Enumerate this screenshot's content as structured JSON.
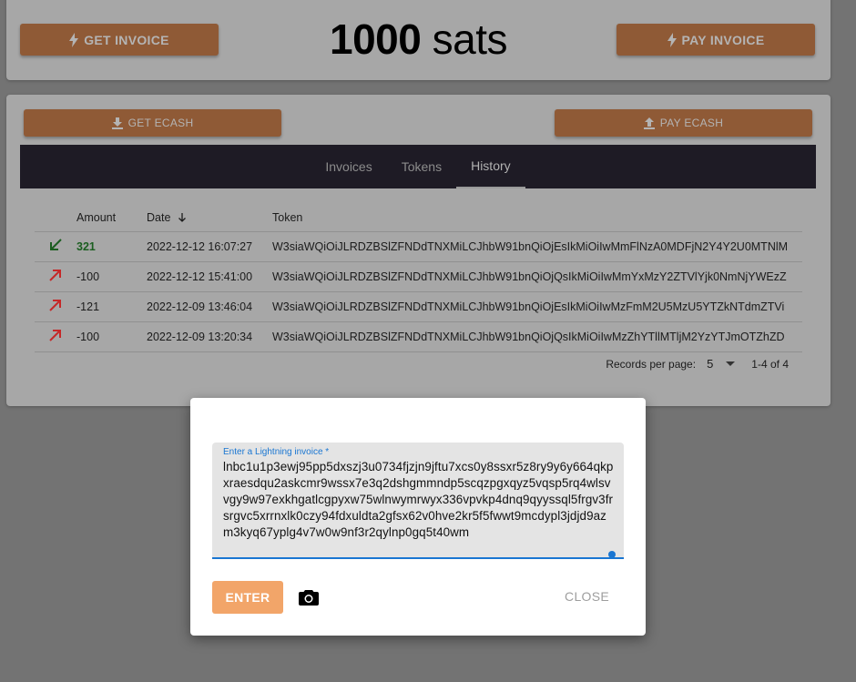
{
  "top": {
    "get_invoice_label": "GET INVOICE",
    "pay_invoice_label": "PAY INVOICE",
    "balance_number": "1000",
    "balance_unit": "sats"
  },
  "ecash": {
    "get_label": "GET ECASH",
    "pay_label": "PAY ECASH"
  },
  "tabs": [
    {
      "label": "Invoices"
    },
    {
      "label": "Tokens"
    },
    {
      "label": "History",
      "active": true
    }
  ],
  "history": {
    "columns": {
      "amount": "Amount",
      "date": "Date",
      "token": "Token"
    },
    "sort_icon": "arrow-down-icon",
    "rows": [
      {
        "direction": "incoming",
        "icon": "arrow-down-left-icon",
        "amount": "321",
        "date": "2022-12-12 16:07:27",
        "token": "W3siaWQiOiJLRDZBSlZFNDdTNXMiLCJhbW91bnQiOjEsIkMiOiIwMmFlNzA0MDFjN2Y4Y2U0MTNlM"
      },
      {
        "direction": "outgoing",
        "icon": "arrow-up-right-icon",
        "amount": "-100",
        "date": "2022-12-12 15:41:00",
        "token": "W3siaWQiOiJLRDZBSlZFNDdTNXMiLCJhbW91bnQiOjQsIkMiOiIwMmYxMzY2ZTVlYjk0NmNjYWEzZ"
      },
      {
        "direction": "outgoing",
        "icon": "arrow-up-right-icon",
        "amount": "-121",
        "date": "2022-12-09 13:46:04",
        "token": "W3siaWQiOiJLRDZBSlZFNDdTNXMiLCJhbW91bnQiOjEsIkMiOiIwMzFmM2U5MzU5YTZkNTdmZTVi"
      },
      {
        "direction": "outgoing",
        "icon": "arrow-up-right-icon",
        "amount": "-100",
        "date": "2022-12-09 13:20:34",
        "token": "W3siaWQiOiJLRDZBSlZFNDdTNXMiLCJhbW91bnQiOjQsIkMiOiIwMzZhYTllMTljM2YzYTJmOTZhZD"
      }
    ],
    "pagination": {
      "records_per_page_label": "Records per page:",
      "records_per_page_value": "5",
      "range": "1-4 of 4"
    }
  },
  "dialog": {
    "field_label": "Enter a Lightning invoice *",
    "field_value": "lnbc1u1p3ewj95pp5dxszj3u0734fjzjn9jftu7xcs0y8ssxr5z8ry9y6y664qkpxraesdqu2askcmr9wssx7e3q2dshgmmndp5scqzpgxqyz5vqsp5rq4wlsvvgy9w97exkhgatlcgpyxw75wlnwymrwyx336vpvkp4dnq9qyyssql5frgv3frsrgvc5xrrnxlk0czy94fdxuldta2gfsx62v0hve2kr5f5fwwt9mcdypl3jdjd9azm3kyq67yplg4v7w0w9nf3r2qylnp0gq5t40wm",
    "enter_label": "ENTER",
    "close_label": "CLOSE",
    "camera_icon": "camera-icon"
  },
  "colors": {
    "backdrop": "#737373",
    "accent": "#f2a569",
    "incoming": "#1b5e20",
    "outgoing": "#c62828",
    "focus": "#1976d2"
  }
}
